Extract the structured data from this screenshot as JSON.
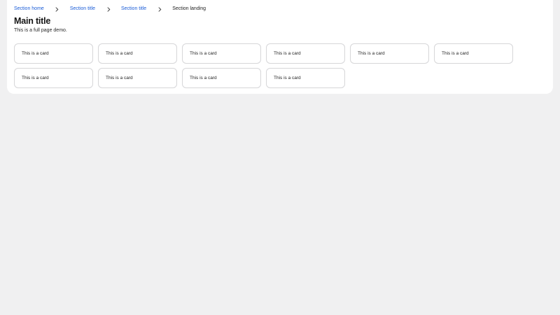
{
  "breadcrumb": {
    "items": [
      {
        "label": "Section home"
      },
      {
        "label": "Section title"
      },
      {
        "label": "Section title"
      }
    ],
    "current": "Section landing",
    "separator_icon": "chevron-right-icon"
  },
  "header": {
    "title": "Main title",
    "subtitle": "This is a full page demo."
  },
  "cards": [
    {
      "label": "This is a card"
    },
    {
      "label": "This is a card"
    },
    {
      "label": "This is a card"
    },
    {
      "label": "This is a card"
    },
    {
      "label": "This is a card"
    },
    {
      "label": "This is a card"
    },
    {
      "label": "This is a card"
    },
    {
      "label": "This is a card"
    },
    {
      "label": "This is a card"
    },
    {
      "label": "This is a card"
    }
  ],
  "colors": {
    "link": "#1a5cd7",
    "background": "#f0f0f1",
    "panel": "#ffffff",
    "card_border": "#d6d6d8"
  }
}
